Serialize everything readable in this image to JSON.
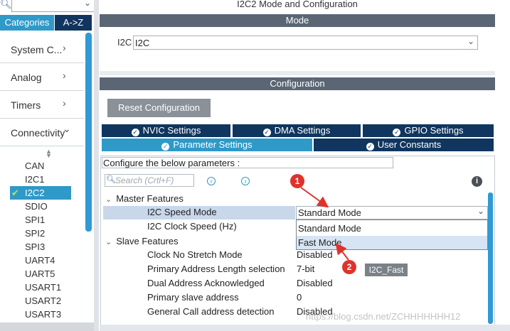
{
  "left_panel": {
    "tabs": [
      "Categories",
      "A->Z"
    ],
    "categories": [
      {
        "label": "System C...",
        "arrow": "›"
      },
      {
        "label": "Analog",
        "arrow": "›"
      },
      {
        "label": "Timers",
        "arrow": "›"
      },
      {
        "label": "Connectivity",
        "arrow": "⌄"
      }
    ],
    "peripherals": [
      "CAN",
      "I2C1",
      "I2C2",
      "SDIO",
      "SPI1",
      "SPI2",
      "SPI3",
      "UART4",
      "UART5",
      "USART1",
      "USART2",
      "USART3"
    ],
    "selected_peripheral": "I2C2",
    "selected_check": "✔"
  },
  "main": {
    "title": "I2C2 Mode and Configuration",
    "mode_header": "Mode",
    "mode_field_label": "I2C",
    "mode_field_value": "I2C",
    "config_header": "Configuration",
    "reset_button": "Reset Configuration",
    "tabs_row1": [
      "NVIC Settings",
      "DMA Settings",
      "GPIO Settings"
    ],
    "tabs_row2": [
      "Parameter Settings",
      "User Constants"
    ],
    "configure_label": "Configure the below parameters :",
    "search_placeholder": "Search (Crtl+F)",
    "master_group": "Master Features",
    "slave_group": "Slave Features",
    "params": [
      {
        "name": "I2C Speed Mode",
        "value": "Standard Mode"
      },
      {
        "name": "I2C Clock Speed (Hz)",
        "value": ""
      },
      {
        "name": "Clock No Stretch Mode",
        "value": "Disabled"
      },
      {
        "name": "Primary Address Length selection",
        "value": "7-bit"
      },
      {
        "name": "Dual Address Acknowledged",
        "value": "Disabled"
      },
      {
        "name": "Primary slave address",
        "value": "0"
      },
      {
        "name": "General Call address detection",
        "value": "Disabled"
      }
    ],
    "dropdown_options": [
      "Standard Mode",
      "Fast Mode"
    ],
    "highlighted_option": "Fast Mode",
    "tooltip": "I2C_Fast"
  },
  "annotations": {
    "badge_1": "1",
    "badge_2": "2",
    "arrow_color": "#e0322d"
  },
  "watermark": "https://blog.csdn.net/ZCHHHHHHH12",
  "colors": {
    "accent": "#2f99c8",
    "dark_tab": "#10355e",
    "header": "#5a6673"
  },
  "icons": [
    "search-icon",
    "chevron-down-icon",
    "chevron-right-icon",
    "check-icon",
    "prev-icon",
    "next-icon",
    "info-icon"
  ]
}
